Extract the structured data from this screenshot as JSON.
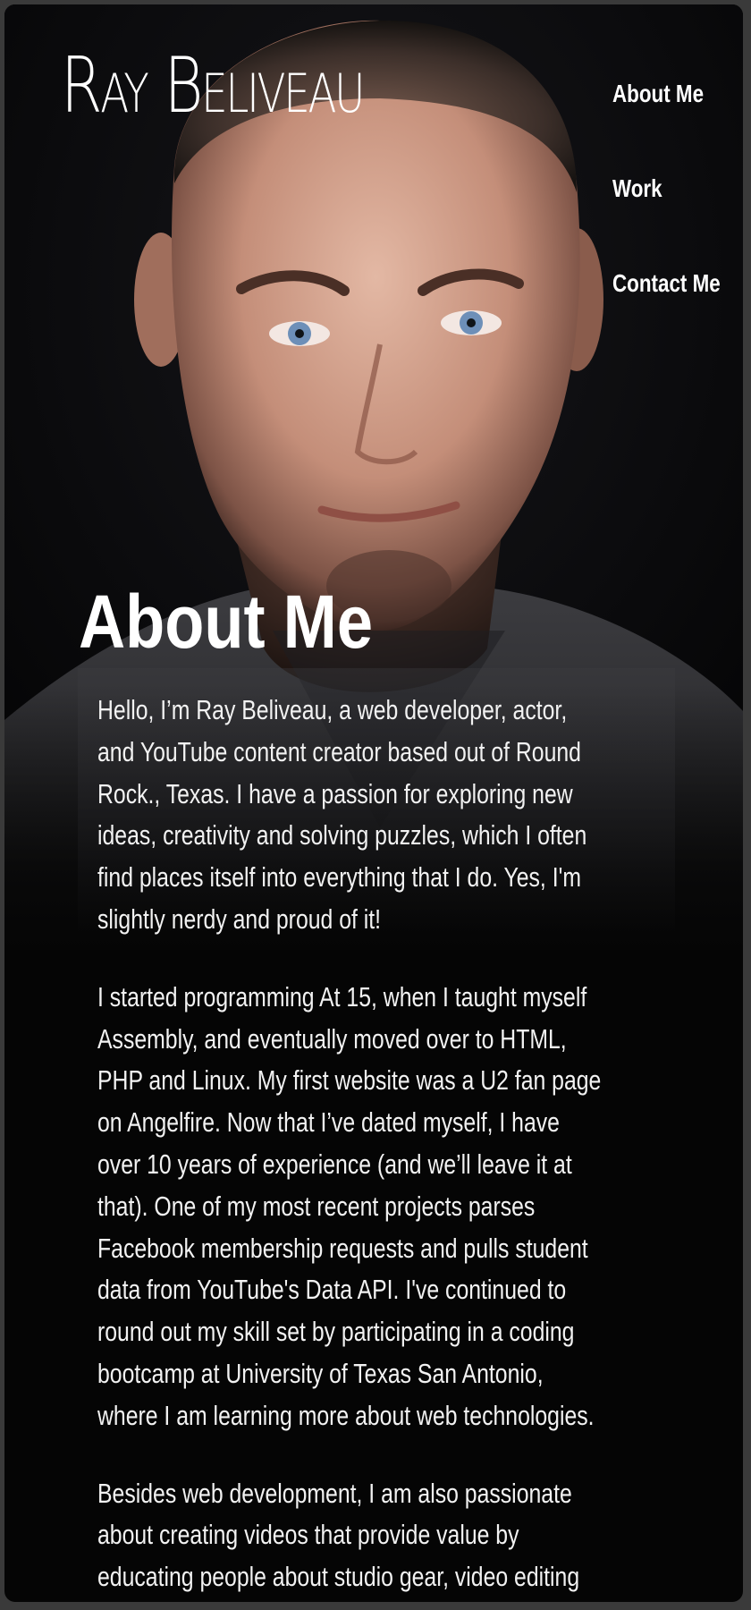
{
  "site": {
    "title": "Ray Beliveau"
  },
  "nav": {
    "items": [
      {
        "label": "About Me"
      },
      {
        "label": "Work"
      },
      {
        "label": "Contact Me"
      }
    ]
  },
  "hero": {
    "image_alt": "Portrait photo of Ray Beliveau"
  },
  "about": {
    "heading": "About Me",
    "paragraphs": [
      "Hello, I’m Ray Beliveau, a web developer, actor, and YouTube content creator based out of Round Rock., Texas. I have a passion for exploring new ideas, creativity and solving puzzles, which I often find places itself into everything that I do. Yes, I'm slightly nerdy and proud of it!",
      "I started programming At 15, when I taught myself Assembly, and eventually moved over to HTML, PHP and Linux. My first website was a U2 fan page on Angelfire. Now that I’ve dated myself, I have over 10 years of experience (and we’ll leave it at that). One of my most recent projects parses Facebook membership requests and pulls student data from YouTube's Data API. I've continued to round out my skill set by participating in a coding bootcamp at University of Texas San Antonio, where I am learning more about web technologies.",
      "Besides web development, I am also passionate about creating videos that provide value by educating people about studio gear, video editing and stories about life."
    ]
  },
  "colors": {
    "page_background": "#050505",
    "outer_frame": "#3a3a3a",
    "text": "#ffffff",
    "eye": "#6d8fb8"
  }
}
